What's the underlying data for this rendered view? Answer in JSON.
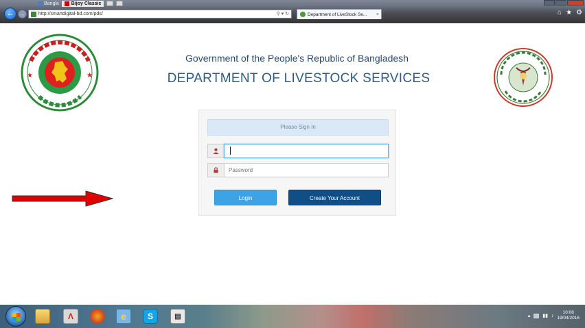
{
  "browser": {
    "address": "http://smartdigital-bd.com/pds/",
    "active_tab": "Department of LiveStock Se...",
    "tab_close": "×",
    "top_strip": {
      "app1": "Bangla",
      "app2": "Bijoy Classic"
    }
  },
  "header": {
    "gov_title": "Government of the People's Republic of Bangladesh",
    "dept_title": "DEPARTMENT OF LIVESTOCK SERVICES"
  },
  "login": {
    "signin_label": "Please Sign In",
    "username_value": "",
    "password_placeholder": "Password",
    "login_label": "Login",
    "create_account_label": "Create Your Account"
  },
  "taskbar": {
    "clock_time": "10:08",
    "clock_date": "19/04/2016"
  },
  "colors": {
    "title_blue": "#2d5b87",
    "login_button": "#3ea3e4",
    "create_button": "#104e85",
    "signin_header_bg": "#dae9f5",
    "arrow_red": "#e00000"
  },
  "icons": {
    "user_icon": "user-icon",
    "lock_icon": "lock-icon"
  }
}
